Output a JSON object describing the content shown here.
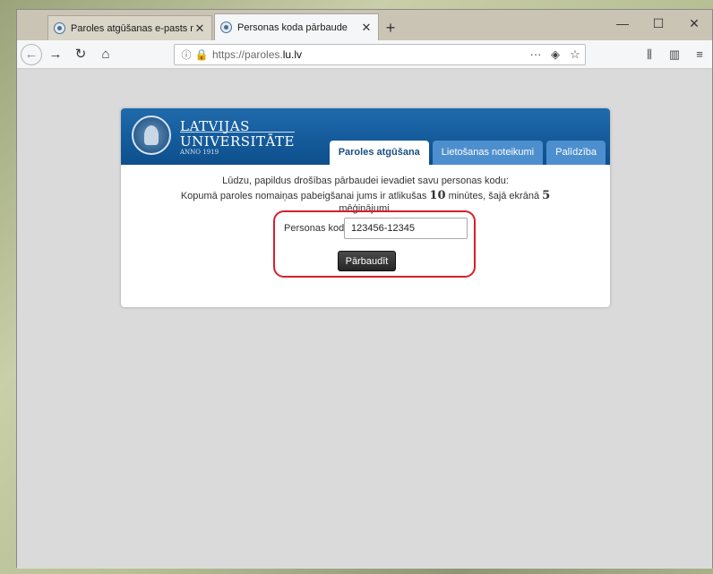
{
  "browser": {
    "tabs": [
      {
        "title": "Paroles atgūšanas e-pasts nosū",
        "active": false
      },
      {
        "title": "Personas koda pārbaude",
        "active": true
      }
    ],
    "new_tab_label": "+",
    "url_prefix": "https://paroles.",
    "url_domain": "lu.lv",
    "icons": {
      "back": "back-arrow-icon",
      "forward": "forward-arrow-icon",
      "reload": "reload-icon",
      "home": "home-icon",
      "info": "info-icon",
      "lock": "lock-icon",
      "more": "more-icon",
      "pocket": "pocket-icon",
      "bookmark": "star-icon",
      "library": "library-icon",
      "sidebar": "sidebar-icon",
      "menu": "menu-icon",
      "minimize": "minimize-icon",
      "maximize": "maximize-icon",
      "close": "close-icon"
    }
  },
  "site": {
    "logo": {
      "line1": "LATVIJAS",
      "line2": "UNIVERSITĀTE",
      "line3": "ANNO 1919"
    },
    "nav_tabs": [
      {
        "label": "Paroles atgūšana",
        "active": true
      },
      {
        "label": "Lietošanas noteikumi",
        "active": false
      },
      {
        "label": "Palīdzība",
        "active": false
      }
    ],
    "message_line1": "Lūdzu, papildus drošības pārbaudei ievadiet savu personas kodu:",
    "message_line2_a": "Kopumā paroles nomaiņas pabeigšanai jums ir atlikušas ",
    "minutes_value": "10",
    "message_line2_b": " minūtes, šajā ekrānā ",
    "attempts_value": "5",
    "message_line3": "mēģinājumi.",
    "form": {
      "label": "Personas kods:",
      "value": "123456-12345",
      "submit_label": "Pārbaudīt"
    },
    "colors": {
      "header_blue": "#1f6aad",
      "highlight_red": "#d81e2c",
      "tab_blue": "#4d8fce"
    }
  }
}
